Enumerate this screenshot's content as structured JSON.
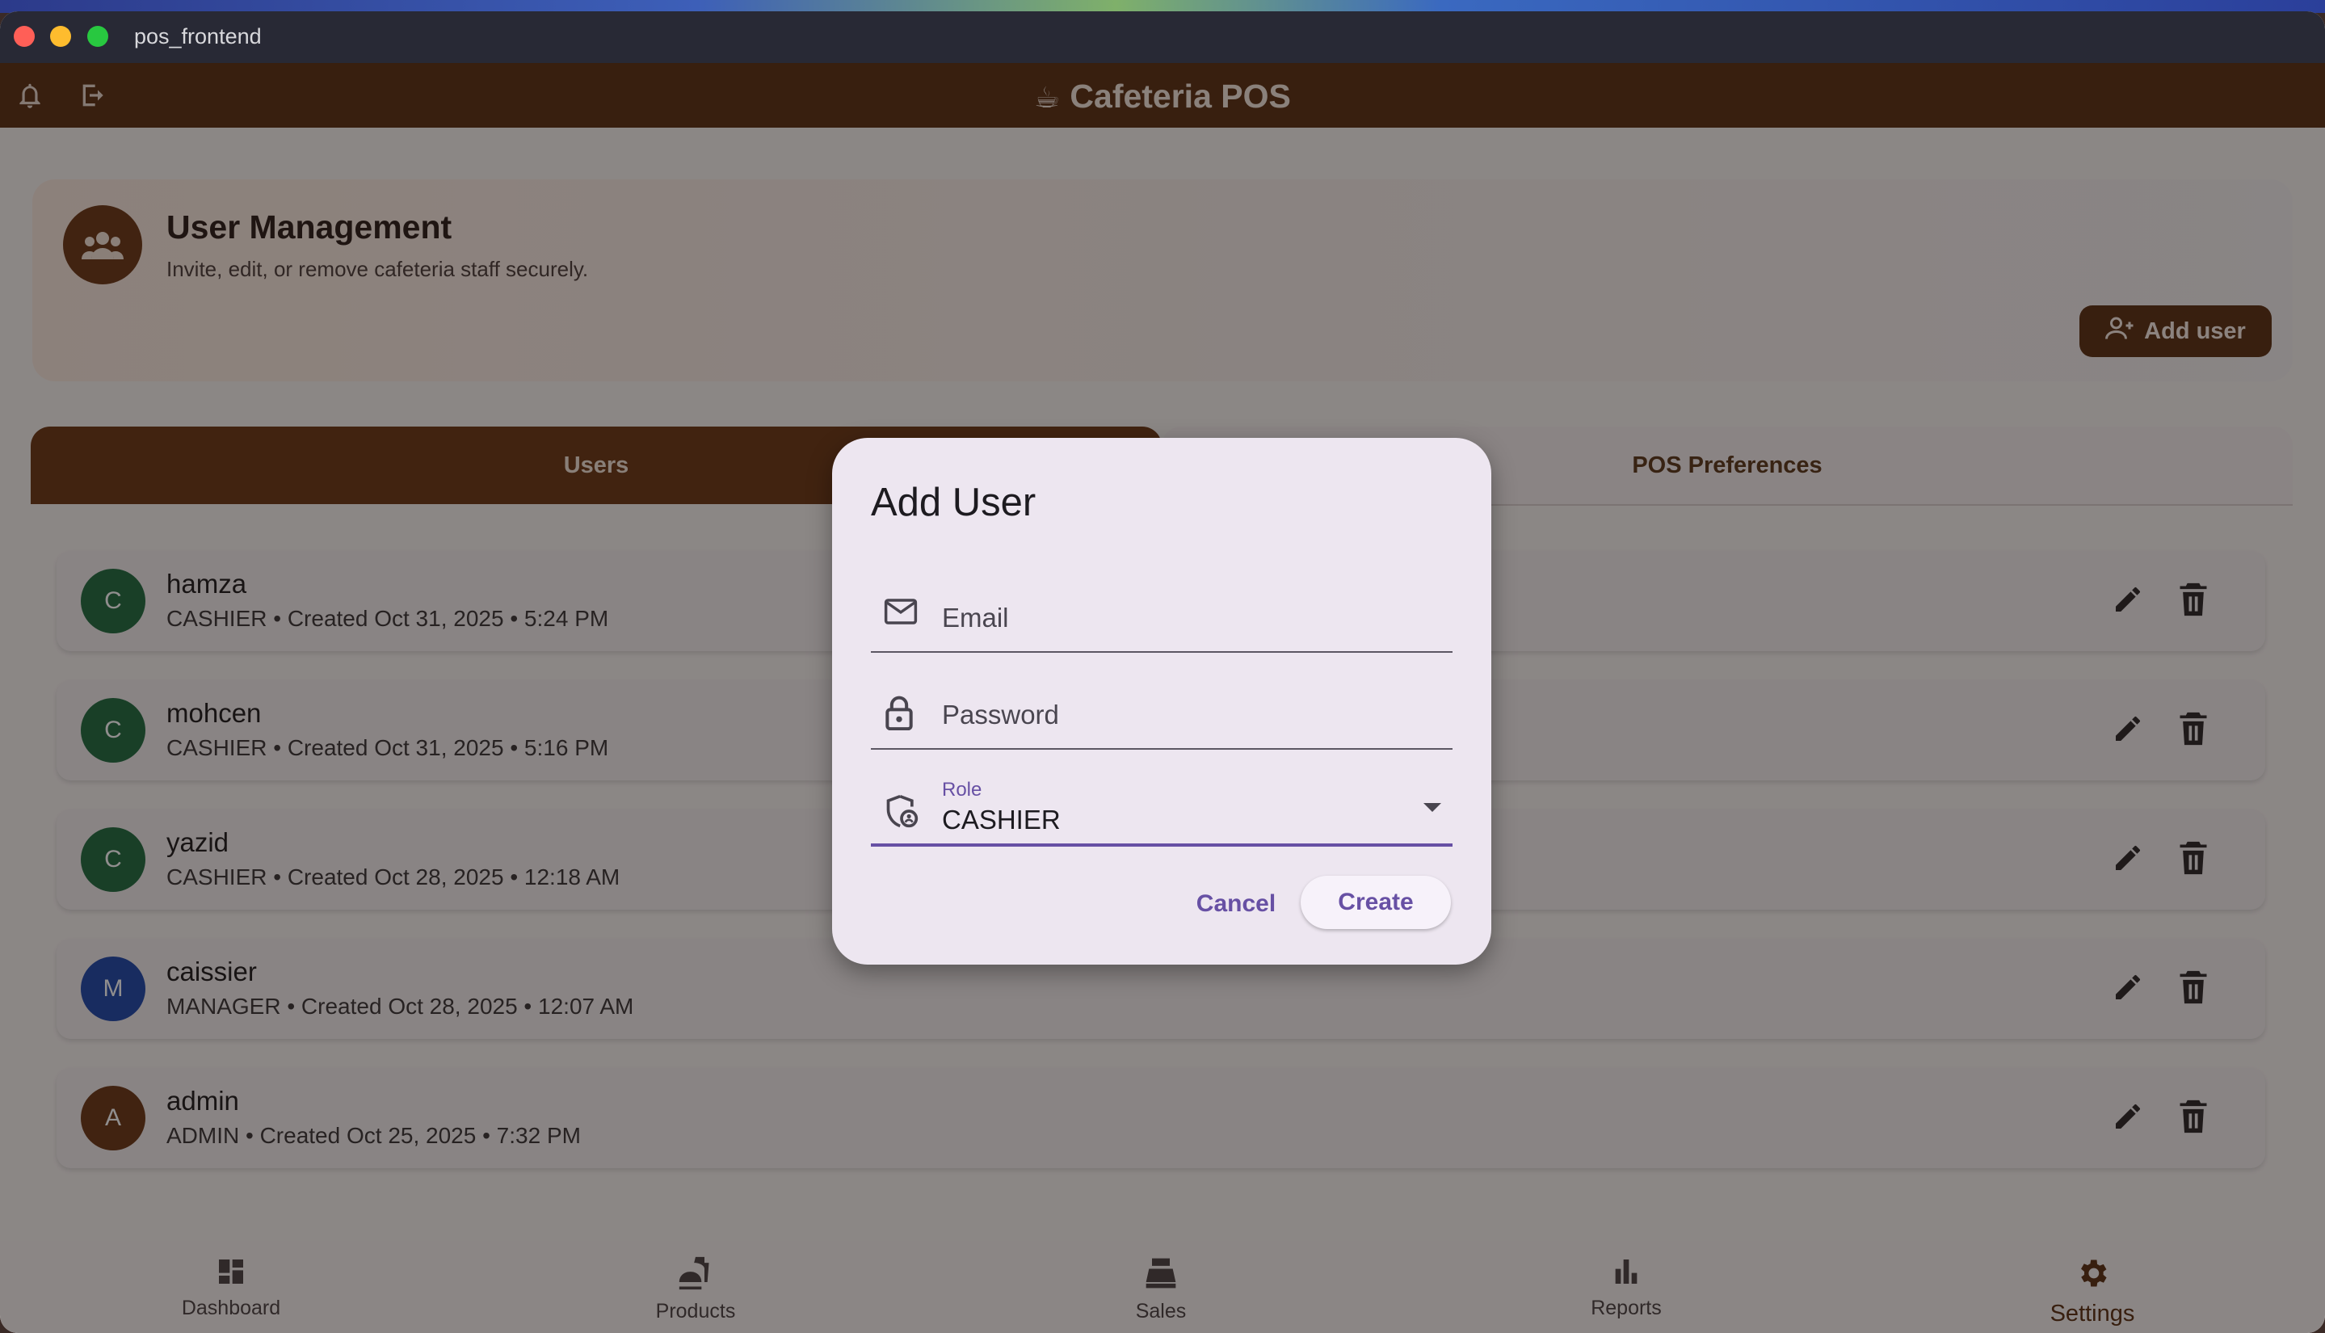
{
  "window": {
    "title": "pos_frontend"
  },
  "appbar": {
    "title": "Cafeteria POS",
    "title_icon": "coffee-cup-icon"
  },
  "header": {
    "title": "User Management",
    "subtitle": "Invite, edit, or remove cafeteria staff securely.",
    "add_user_label": "Add user"
  },
  "tabs": [
    {
      "label": "Users",
      "active": true
    },
    {
      "label": "POS Preferences",
      "active": false
    }
  ],
  "users": [
    {
      "initial": "C",
      "name": "hamza",
      "meta": "CASHIER • Created Oct 31, 2025 • 5:24 PM",
      "color": "#1f6b3e"
    },
    {
      "initial": "C",
      "name": "mohcen",
      "meta": "CASHIER • Created Oct 31, 2025 • 5:16 PM",
      "color": "#1f6b3e"
    },
    {
      "initial": "C",
      "name": "yazid",
      "meta": "CASHIER • Created Oct 28, 2025 • 12:18 AM",
      "color": "#1f6b3e"
    },
    {
      "initial": "M",
      "name": "caissier",
      "meta": "MANAGER • Created Oct 28, 2025 • 12:07 AM",
      "color": "#1e46a8"
    },
    {
      "initial": "A",
      "name": "admin",
      "meta": "ADMIN • Created Oct 25, 2025 • 7:32 PM",
      "color": "#6a3513"
    }
  ],
  "nav": [
    {
      "label": "Dashboard",
      "icon": "dashboard-icon",
      "active": false
    },
    {
      "label": "Products",
      "icon": "products-icon",
      "active": false
    },
    {
      "label": "Sales",
      "icon": "sales-icon",
      "active": false
    },
    {
      "label": "Reports",
      "icon": "reports-icon",
      "active": false
    },
    {
      "label": "Settings",
      "icon": "settings-icon",
      "active": true
    }
  ],
  "dialog": {
    "title": "Add User",
    "email_placeholder": "Email",
    "password_placeholder": "Password",
    "role_label": "Role",
    "role_value": "CASHIER",
    "cancel_label": "Cancel",
    "create_label": "Create"
  },
  "colors": {
    "brand": "#5a2e10",
    "accent": "#6750a4"
  }
}
